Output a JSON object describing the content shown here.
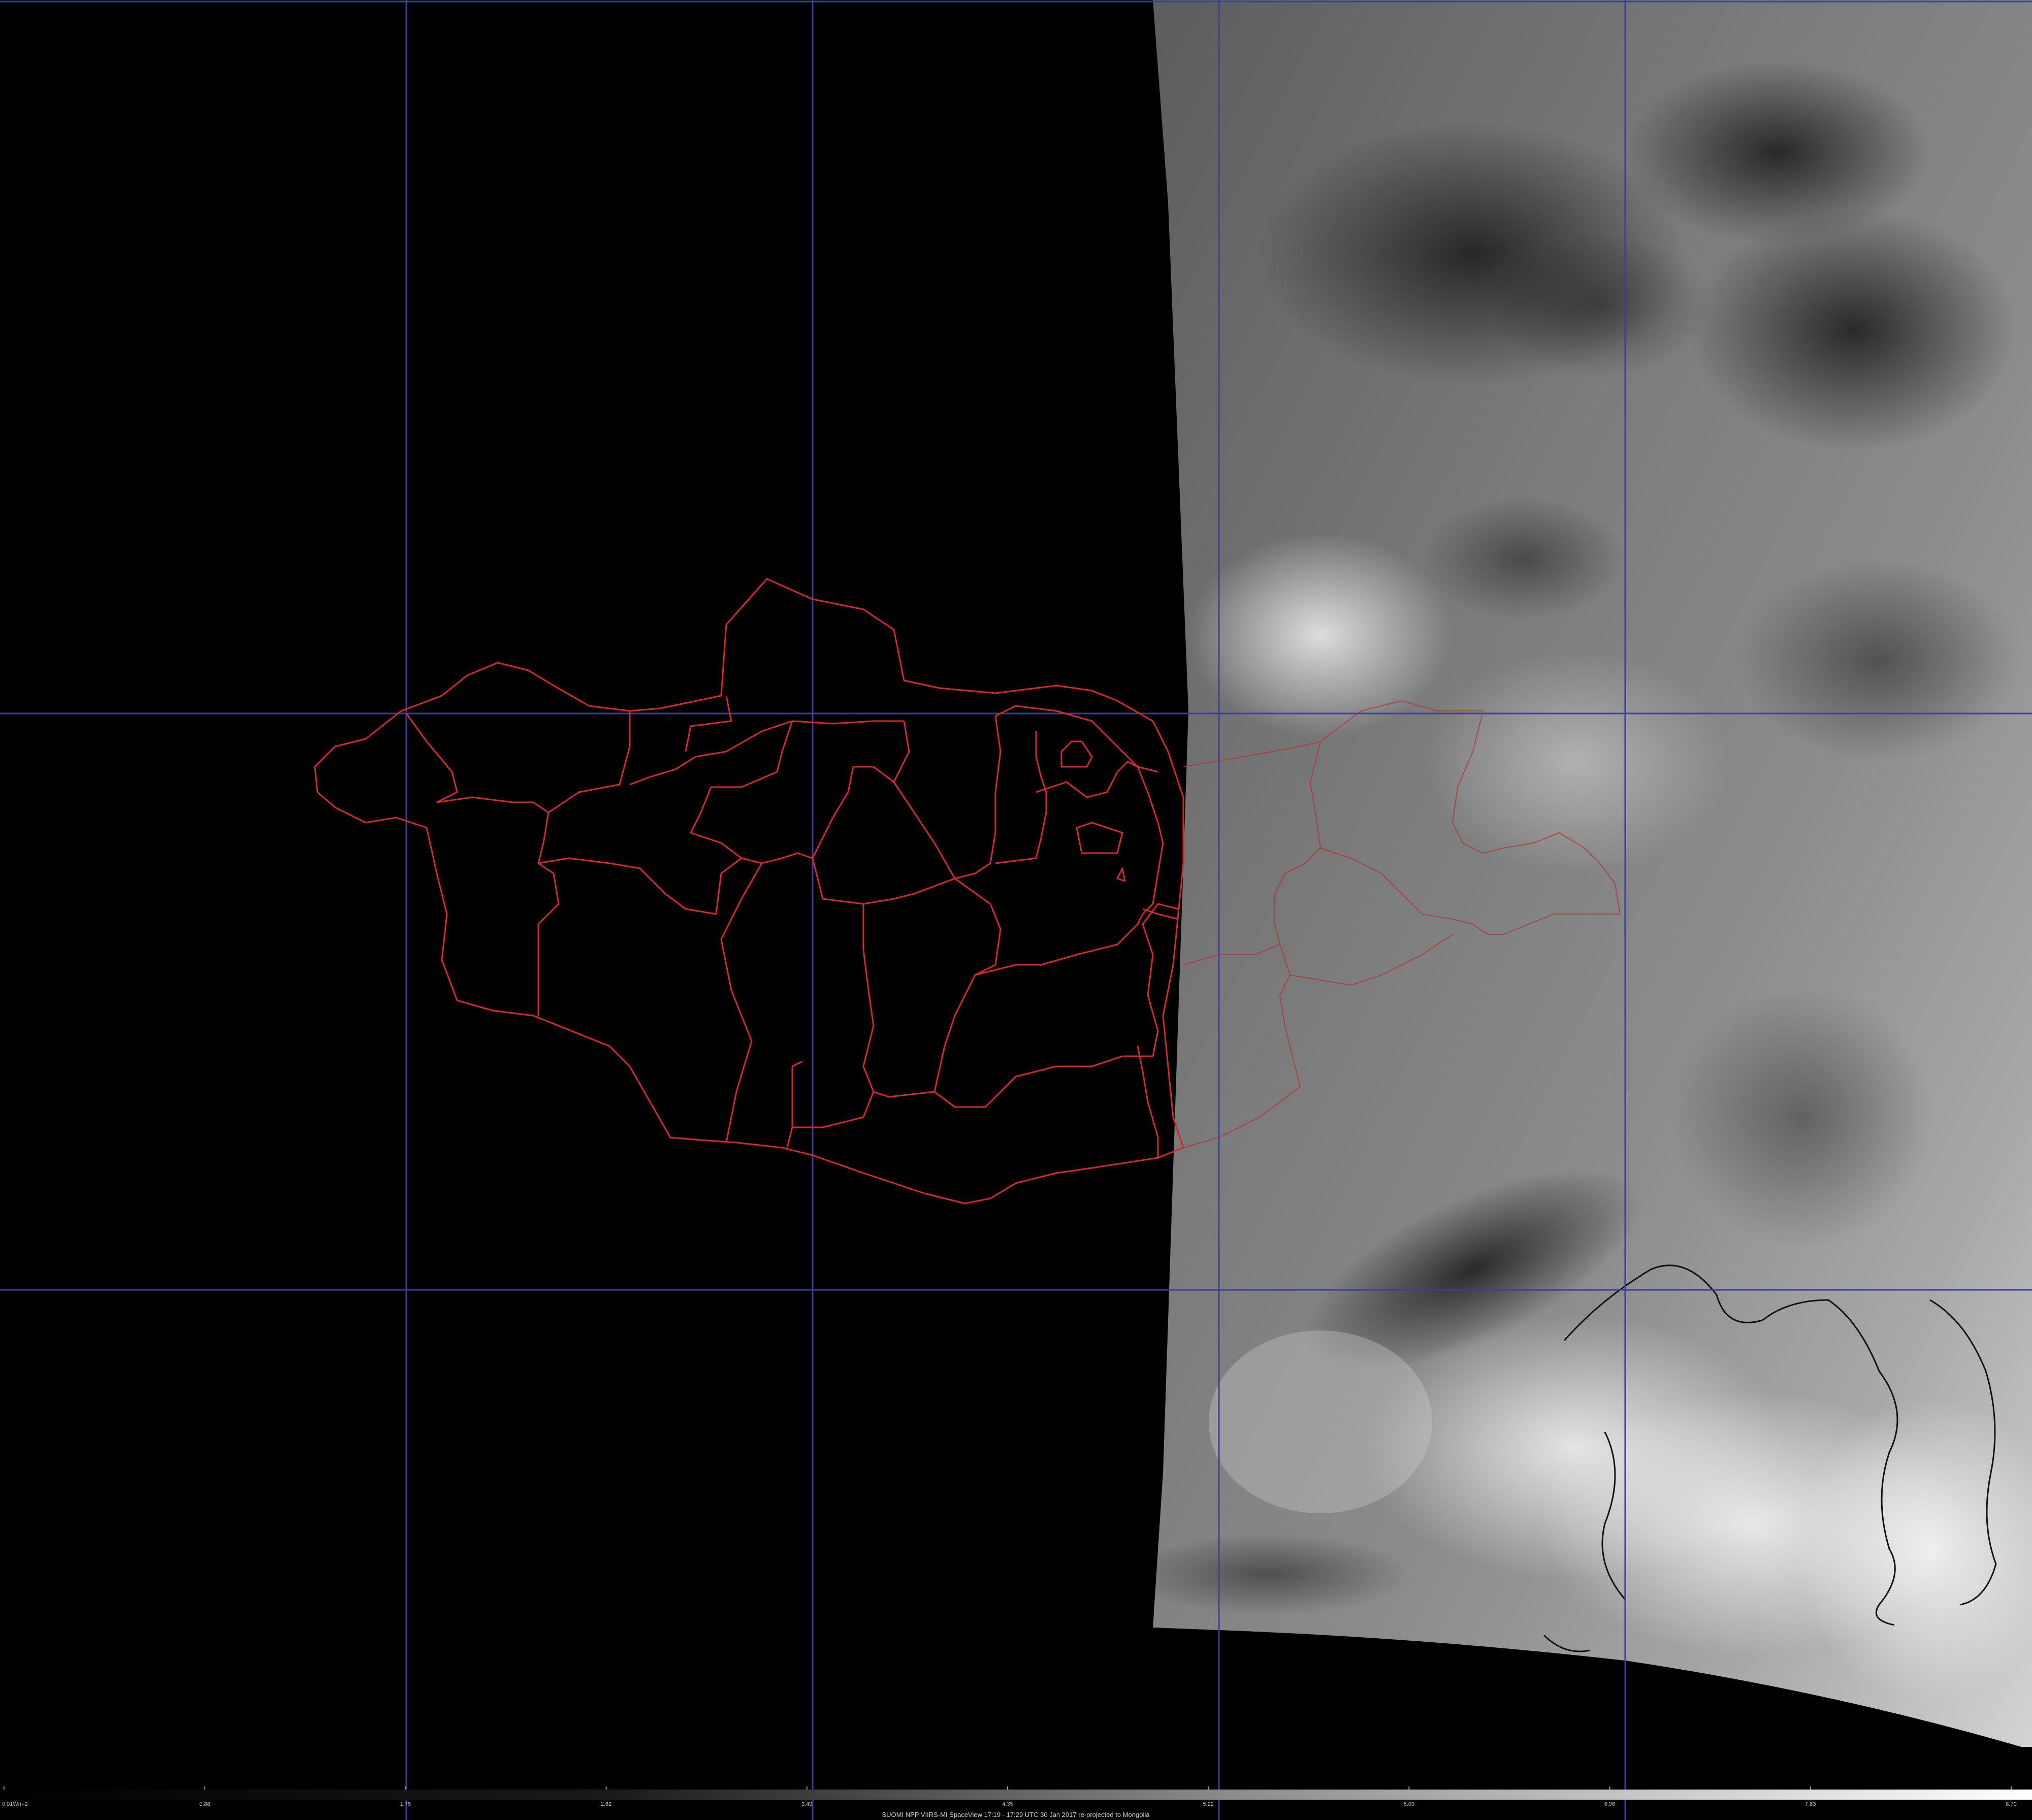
{
  "map": {
    "caption": "SUOMI NPP VIIRS-MI SpaceView 17:19 - 17:29 UTC 30 Jan 2017 re-projected to Mongolia",
    "colors": {
      "background": "#000000",
      "grid": "#3a3f9a",
      "admin_borders": "#d42a2a",
      "coastline": "#111111",
      "scale_tick": "#9a9a9a"
    },
    "layers": [
      "satellite-imagery",
      "graticule",
      "mongolia-province-borders",
      "coastline",
      "radiance-scale-bar"
    ],
    "scale_bar": {
      "type": "grayscale-gradient",
      "range": [
        0.01,
        8.7
      ],
      "labels": [
        "0.01Wm-2",
        "0.88",
        "1.75",
        "2.62",
        "3.49",
        "4.35",
        "5.22",
        "6.09",
        "6.96",
        "7.83",
        "8.70"
      ]
    }
  }
}
